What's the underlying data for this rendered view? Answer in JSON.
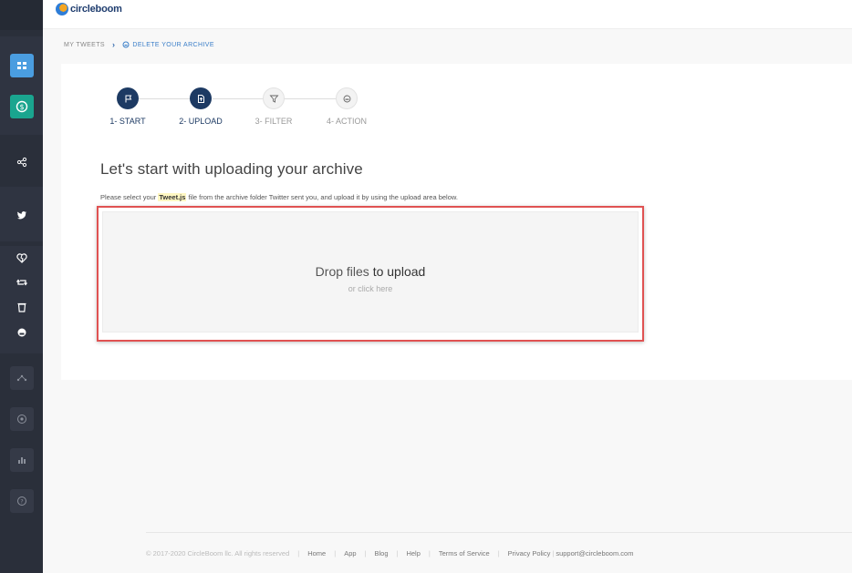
{
  "header": {
    "logo_text": "circleboom"
  },
  "breadcrumb": {
    "parent": "MY TWEETS",
    "current": "DELETE YOUR ARCHIVE"
  },
  "stepper": {
    "steps": [
      {
        "label": "1- START",
        "icon": "flag-icon"
      },
      {
        "label": "2- UPLOAD",
        "icon": "file-upload-icon"
      },
      {
        "label": "3- FILTER",
        "icon": "filter-icon"
      },
      {
        "label": "4- ACTION",
        "icon": "delete-action-icon"
      }
    ]
  },
  "main": {
    "heading": "Let's start with uploading your archive",
    "instruction_pre": "Please select your ",
    "instruction_file": "Tweet.js",
    "instruction_post": " file from the archive folder Twitter sent you, and upload it by using the upload area below."
  },
  "dropzone": {
    "title_a": "Drop files ",
    "title_b": "to upload",
    "subtitle": "or click here"
  },
  "footer": {
    "copyright": "© 2017-2020 CircleBoom llc. All rights reserved",
    "links": [
      "Home",
      "App",
      "Blog",
      "Help",
      "Terms of Service",
      "Privacy Policy"
    ],
    "email": "support@circleboom.com"
  },
  "colors": {
    "accent": "#1d3a63",
    "sidebar": "#2a2f3a",
    "dashboard_btn": "#4a9de0",
    "billing_btn": "#1aa58f",
    "highlight_border": "#e05252"
  }
}
